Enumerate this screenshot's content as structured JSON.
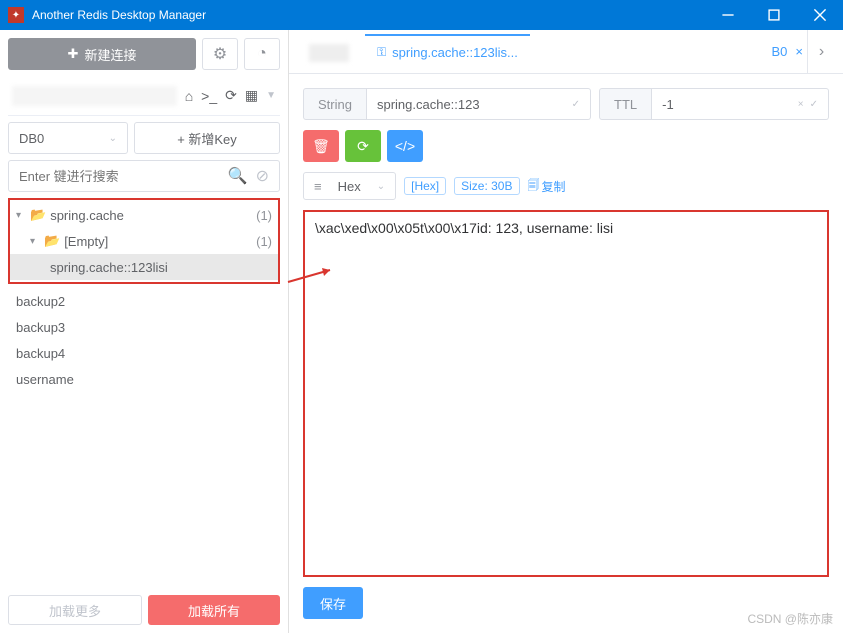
{
  "window": {
    "title": "Another Redis Desktop Manager"
  },
  "sidebar": {
    "new_conn": "新建连接",
    "db_label": "DB0",
    "add_key": "+ 新增Key",
    "search_placeholder": "Enter 键进行搜索",
    "tree": {
      "root": {
        "label": "spring.cache",
        "count": "(1)"
      },
      "child": {
        "label": "[Empty]",
        "count": "(1)"
      },
      "leaf": "spring.cache::123lisi"
    },
    "siblings": [
      "backup2",
      "backup3",
      "backup4",
      "username"
    ],
    "load_more": "加载更多",
    "load_all": "加载所有"
  },
  "tabs": {
    "active_label": "spring.cache::123lis...",
    "end_label": "B0"
  },
  "key": {
    "type": "String",
    "name": "spring.cache::123",
    "ttl_label": "TTL",
    "ttl_value": "-1"
  },
  "format": {
    "selected": "Hex",
    "hex_pill": "[Hex]",
    "size_pill": "Size: 30B",
    "copy": "复制"
  },
  "value": "\\xac\\xed\\x00\\x05t\\x00\\x17id: 123, username: lisi",
  "save": "保存",
  "watermark": "CSDN @陈亦康"
}
